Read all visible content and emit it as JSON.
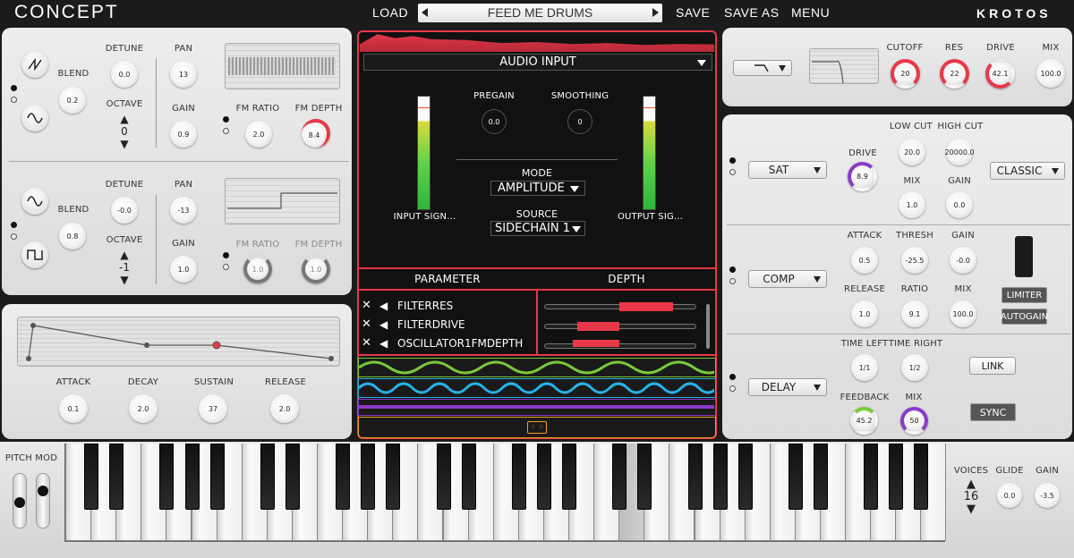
{
  "header": {
    "logo": "CONCEPT",
    "load": "LOAD",
    "preset": "FEED ME DRUMS",
    "save": "SAVE",
    "save_as": "SAVE AS",
    "menu": "MENU",
    "brand": "KROTOS"
  },
  "osc1": {
    "blend_label": "BLEND",
    "blend": "0.2",
    "detune_label": "DETUNE",
    "detune": "0.0",
    "octave_label": "OCTAVE",
    "octave": "0",
    "pan_label": "PAN",
    "pan": "13",
    "gain_label": "GAIN",
    "gain": "0.9",
    "fm_ratio_label": "FM RATIO",
    "fm_ratio": "2.0",
    "fm_depth_label": "FM DEPTH",
    "fm_depth": "8.4"
  },
  "osc2": {
    "blend_label": "BLEND",
    "blend": "0.8",
    "detune_label": "DETUNE",
    "detune": "-0.0",
    "octave_label": "OCTAVE",
    "octave": "-1",
    "pan_label": "PAN",
    "pan": "-13",
    "gain_label": "GAIN",
    "gain": "1.0",
    "fm_ratio_label": "FM RATIO",
    "fm_ratio": "1.0",
    "fm_depth_label": "FM DEPTH",
    "fm_depth": "1.0"
  },
  "envelope": {
    "attack_label": "ATTACK",
    "attack": "0.1",
    "decay_label": "DECAY",
    "decay": "2.0",
    "sustain_label": "SUSTAIN",
    "sustain": "37",
    "release_label": "RELEASE",
    "release": "2.0"
  },
  "audio_input": {
    "title": "AUDIO INPUT",
    "pregain_label": "PREGAIN",
    "pregain": "0.0",
    "smoothing_label": "SMOOTHING",
    "smoothing": "0",
    "input_label": "INPUT SIGN...",
    "output_label": "OUTPUT SIG...",
    "mode_label": "MODE",
    "mode": "AMPLITUDE",
    "source_label": "SOURCE",
    "source": "SIDECHAIN 1"
  },
  "mod_matrix": {
    "param_header": "PARAMETER",
    "depth_header": "DEPTH",
    "rows": [
      "FILTERRES",
      "FILTERDRIVE",
      "OSCILLATOR1FMDEPTH"
    ]
  },
  "filter": {
    "cutoff_label": "CUTOFF",
    "cutoff": "20",
    "res_label": "RES",
    "res": "22",
    "drive_label": "DRIVE",
    "drive": "42.1",
    "mix_label": "MIX",
    "mix": "100.0"
  },
  "sat": {
    "type": "SAT",
    "mode": "CLASSIC",
    "drive_label": "DRIVE",
    "drive": "8.9",
    "lowcut_label": "LOW CUT",
    "lowcut": "20.0",
    "highcut_label": "HIGH CUT",
    "highcut": "20000.0",
    "mix_label": "MIX",
    "mix": "1.0",
    "gain_label": "GAIN",
    "gain": "0.0"
  },
  "comp": {
    "type": "COMP",
    "attack_label": "ATTACK",
    "attack": "0.5",
    "thresh_label": "THRESH",
    "thresh": "-25.5",
    "gain_label": "GAIN",
    "gain": "-0.0",
    "release_label": "RELEASE",
    "release": "1.0",
    "ratio_label": "RATIO",
    "ratio": "9.1",
    "mix_label": "MIX",
    "mix": "100.0",
    "limiter": "LIMITER",
    "autogain": "AUTOGAIN"
  },
  "delay": {
    "type": "DELAY",
    "time_left_label": "TIME LEFT",
    "time_left": "1/1",
    "time_right_label": "TIME RIGHT",
    "time_right": "1/2",
    "link": "LINK",
    "feedback_label": "FEEDBACK",
    "feedback": "45.2",
    "mix_label": "MIX",
    "mix": "50",
    "sync": "SYNC"
  },
  "keyboard": {
    "pitch_mod_label": "PITCH MOD",
    "voices_label": "VOICES",
    "voices": "16",
    "glide_label": "GLIDE",
    "glide": "0.0",
    "gain_label": "GAIN",
    "gain": "-3.5"
  },
  "colors": {
    "accent_red": "#e83848",
    "green": "#7ac93a",
    "blue": "#27b1e6",
    "purple": "#8a3cc8",
    "orange": "#f0a020"
  }
}
